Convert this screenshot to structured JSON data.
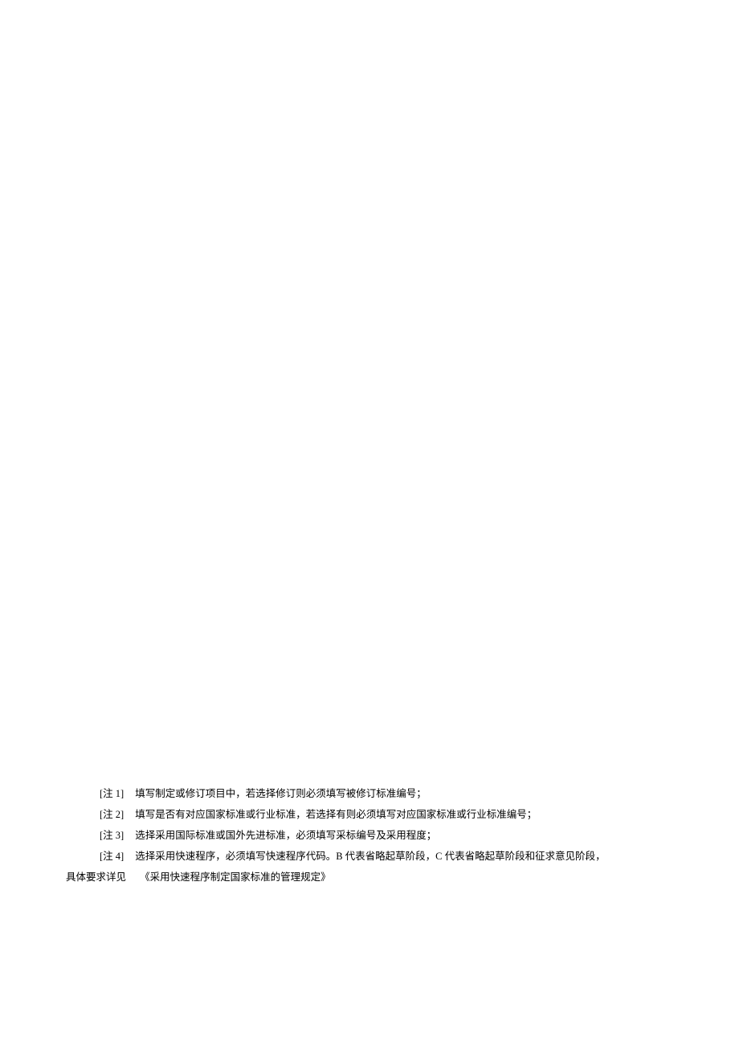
{
  "notes": {
    "items": [
      {
        "label": "[注 1]",
        "text": "填写制定或修订项目中，若选择修订则必须填写被修订标准编号；"
      },
      {
        "label": "[注 2]",
        "text": "填写是否有对应国家标准或行业标准，若选择有则必须填写对应国家标准或行业标准编号；"
      },
      {
        "label": "[注 3]",
        "text": "选择采用国际标准或国外先进标准，必须填写采标编号及采用程度；"
      },
      {
        "label": "[注 4]",
        "text": "选择采用快速程序，必须填写快速程序代码。B 代表省略起草阶段，C 代表省略起草阶段和征求意见阶段，"
      }
    ],
    "continuation": {
      "prefix": "具体要求详见",
      "text": "《采用快速程序制定国家标准的管理规定》"
    }
  }
}
